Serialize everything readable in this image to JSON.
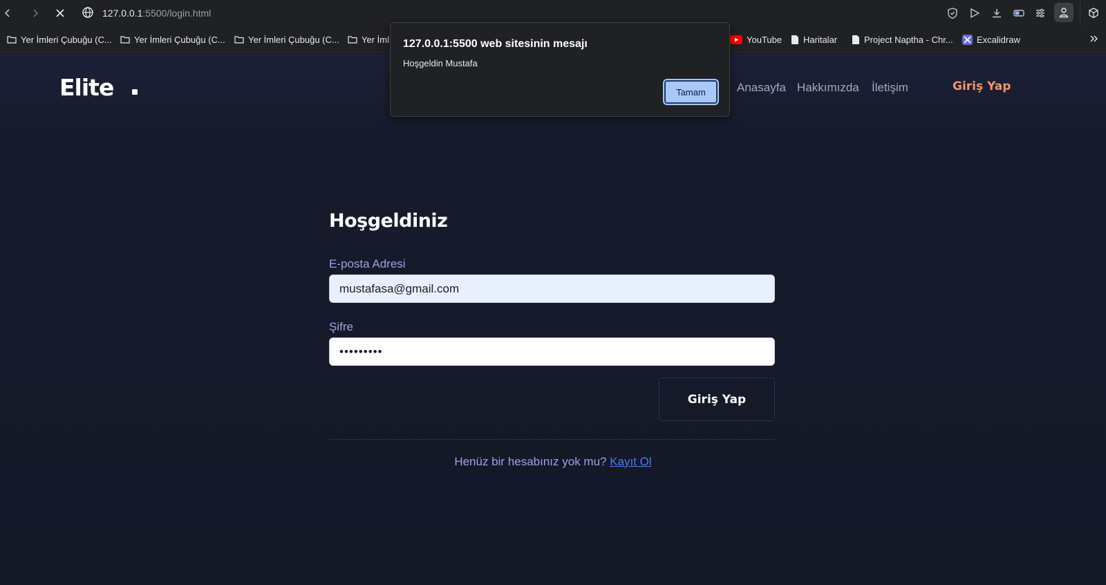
{
  "browser": {
    "url_host": "127.0.0.1",
    "url_path": ":5500/login.html",
    "bookmarks": [
      {
        "label": "Yer İmleri Çubuğu (C...",
        "icon": "folder-icon"
      },
      {
        "label": "Yer İmleri Çubuğu (C...",
        "icon": "folder-icon"
      },
      {
        "label": "Yer İmleri Çubuğu (C...",
        "icon": "folder-icon"
      },
      {
        "label": "Yer İml",
        "icon": "folder-icon"
      },
      {
        "label": "YouTube",
        "icon": "youtube-icon"
      },
      {
        "label": "Haritalar",
        "icon": "page-icon"
      },
      {
        "label": "Project Naptha - Chr...",
        "icon": "page-icon"
      },
      {
        "label": "Excalidraw",
        "icon": "excalidraw-icon"
      }
    ]
  },
  "header": {
    "logo": "Elite",
    "nav": [
      "Anasayfa",
      "Hakkımızda",
      "İletişim"
    ],
    "cta": "Giriş Yap"
  },
  "form": {
    "title": "Hoşgeldiniz",
    "email_label": "E-posta Adresi",
    "email_value": "mustafasa@gmail.com",
    "password_label": "Şifre",
    "password_mask": "•••••••••",
    "submit_label": "Giriş Yap",
    "footer_text": "Henüz bir hesabınız yok mu?",
    "footer_link": "Kayıt Ol"
  },
  "dialog": {
    "title": "127.0.0.1:5500 web sitesinin mesajı",
    "message": "Hoşgeldin Mustafa",
    "ok_label": "Tamam"
  },
  "colors": {
    "background": "#161a2b",
    "accent": "#f0966a",
    "label": "#9da3e6",
    "link": "#4a7cf7",
    "dialog_button": "#a8c7fa"
  }
}
